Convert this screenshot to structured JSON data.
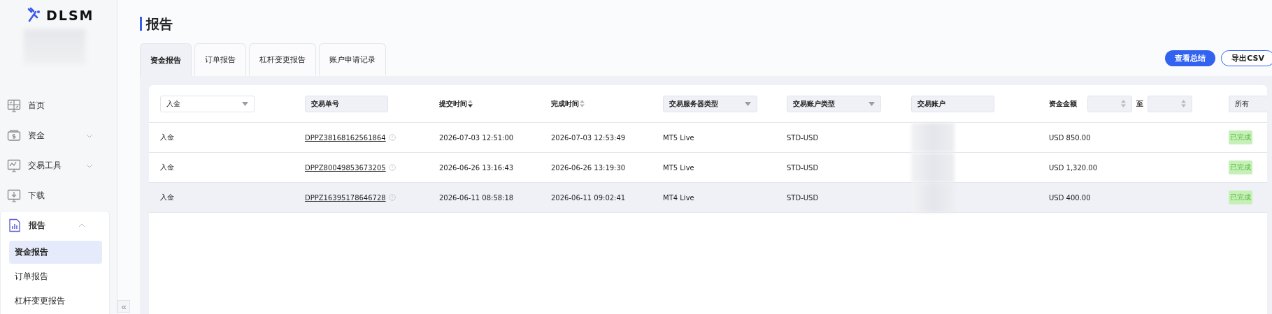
{
  "sidebar": {
    "logo_text": "DLSM",
    "collapse_label": "«",
    "items": [
      {
        "label": "首页",
        "kind": "home"
      },
      {
        "label": "资金",
        "kind": "funds",
        "expanded": false
      },
      {
        "label": "交易工具",
        "kind": "tools",
        "expanded": false
      },
      {
        "label": "下载",
        "kind": "download"
      },
      {
        "label": "报告",
        "kind": "report",
        "expanded": true,
        "children": [
          {
            "label": "资金报告",
            "selected": true
          },
          {
            "label": "订单报告",
            "selected": false
          },
          {
            "label": "杠杆变更报告",
            "selected": false
          }
        ]
      }
    ]
  },
  "page": {
    "title": "报告"
  },
  "tabs": [
    {
      "label": "资金报告",
      "selected": true
    },
    {
      "label": "订单报告",
      "selected": false
    },
    {
      "label": "杠杆变更报告",
      "selected": false
    },
    {
      "label": "账户申请记录",
      "selected": false
    }
  ],
  "actions": [
    {
      "label": "查看总结",
      "kind": "primary"
    },
    {
      "label": "导出CSV",
      "kind": "outline"
    }
  ],
  "table": {
    "columns": [
      {
        "kind": "select",
        "value": "入金"
      },
      {
        "kind": "input",
        "label": "交易单号"
      },
      {
        "kind": "sort",
        "label": "提交时间",
        "sorted_desc": true
      },
      {
        "kind": "sort",
        "label": "完成时间",
        "sorted_desc": false
      },
      {
        "kind": "select",
        "value": "交易服务器类型"
      },
      {
        "kind": "select",
        "value": "交易账户类型"
      },
      {
        "kind": "input",
        "label": "交易账户"
      },
      {
        "kind": "range",
        "label": "资金金额",
        "separator": "至"
      },
      {
        "kind": "select",
        "value": "所有"
      }
    ],
    "rows": [
      {
        "type": "入金",
        "order_no": "DPPZ38168162561864",
        "submitted": "2026-07-03 12:51:00",
        "completed": "2026-07-03 12:53:49",
        "server": "MT5 Live",
        "account_type": "STD-USD",
        "amount": "USD 850.00",
        "status": "已完成",
        "selected": false
      },
      {
        "type": "入金",
        "order_no": "DPPZ80049853673205",
        "submitted": "2026-06-26 13:16:43",
        "completed": "2026-06-26 13:19:30",
        "server": "MT5 Live",
        "account_type": "STD-USD",
        "amount": "USD 1,320.00",
        "status": "已完成",
        "selected": false
      },
      {
        "type": "入金",
        "order_no": "DPPZ16395178646728",
        "submitted": "2026-06-11 08:58:18",
        "completed": "2026-06-11 09:02:41",
        "server": "MT4 Live",
        "account_type": "STD-USD",
        "amount": "USD 400.00",
        "status": "已完成",
        "selected": true
      }
    ]
  }
}
